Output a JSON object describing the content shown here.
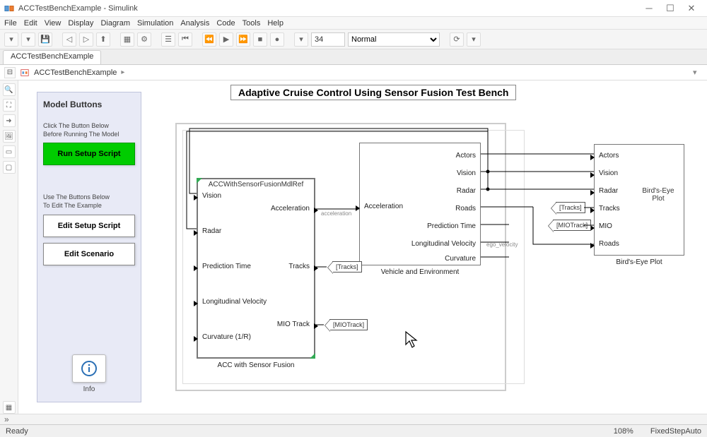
{
  "window": {
    "title": "ACCTestBenchExample - Simulink"
  },
  "menus": [
    "File",
    "Edit",
    "View",
    "Display",
    "Diagram",
    "Simulation",
    "Analysis",
    "Code",
    "Tools",
    "Help"
  ],
  "toolbar": {
    "stop_time": "34",
    "mode": "Normal"
  },
  "tab": {
    "name": "ACCTestBenchExample"
  },
  "breadcrumb": {
    "model": "ACCTestBenchExample"
  },
  "diagram_title": "Adaptive Cruise Control Using Sensor Fusion Test Bench",
  "panel": {
    "title": "Model Buttons",
    "hint1a": "Click The Button Below",
    "hint1b": "Before Running The Model",
    "run_setup": "Run Setup Script",
    "hint2a": "Use The Buttons Below",
    "hint2b": "To Edit The Example",
    "edit_setup": "Edit Setup Script",
    "edit_scenario": "Edit Scenario",
    "info": "Info"
  },
  "acc": {
    "ref": "ACCWithSensorFusionMdlRef",
    "label": "ACC with Sensor Fusion",
    "in": [
      "Vision",
      "Radar",
      "Prediction Time",
      "Longitudinal Velocity",
      "Curvature (1/R)"
    ],
    "out": [
      "Acceleration",
      "Tracks",
      "MIO Track"
    ]
  },
  "veh": {
    "label": "Vehicle and Environment",
    "left": [
      "Acceleration"
    ],
    "right": [
      "Actors",
      "Vision",
      "Radar",
      "Roads",
      "Prediction Time",
      "Longitudinal Velocity",
      "Curvature"
    ]
  },
  "bep": {
    "title": "Bird's-Eye Plot",
    "label": "Bird's-Eye Plot",
    "in": [
      "Actors",
      "Vision",
      "Radar",
      "Tracks",
      "MIO",
      "Roads"
    ]
  },
  "tags": {
    "tracks": "[Tracks]",
    "mio": "[MIOTrack]",
    "tracks2": "[Tracks]",
    "mio2": "[MIOTrack]"
  },
  "signals": {
    "accel": "acceleration",
    "ego": "ego_velocity"
  },
  "status": {
    "ready": "Ready",
    "zoom": "108%",
    "solver": "FixedStepAuto"
  }
}
